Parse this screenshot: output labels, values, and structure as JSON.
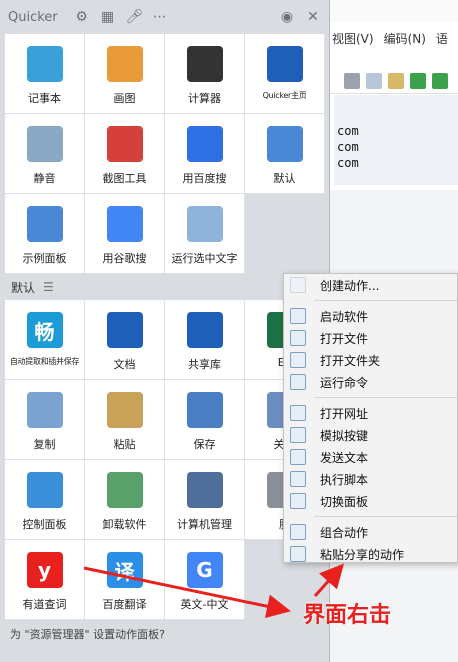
{
  "header": {
    "app_title": "Quicker",
    "icons": [
      "gear-icon",
      "qr-code-icon",
      "microphone-icon",
      "more-icon",
      "user-circle-icon",
      "close-icon"
    ]
  },
  "top_grid": [
    {
      "label": "记事本",
      "icon": "notepad-icon",
      "color": "#3aa0d8"
    },
    {
      "label": "画图",
      "icon": "paint-palette-icon",
      "color": "#e99a39"
    },
    {
      "label": "计算器",
      "icon": "calculator-icon",
      "color": "#333333"
    },
    {
      "label": "Quicker主页",
      "icon": "lightning-icon",
      "color": "#1f5fb7"
    },
    {
      "label": "静音",
      "icon": "speaker-mute-icon",
      "color": "#8aa7c4"
    },
    {
      "label": "截图工具",
      "icon": "scissors-icon",
      "color": "#d6403a"
    },
    {
      "label": "用百度搜",
      "icon": "baidu-paw-icon",
      "color": "#2f6fe4"
    },
    {
      "label": "默认",
      "icon": "window-stack-icon",
      "color": "#4a87d6"
    },
    {
      "label": "示例面板",
      "icon": "window-stack-icon",
      "color": "#4a87d6"
    },
    {
      "label": "用谷歌搜",
      "icon": "google-g-icon",
      "color": "#4285f4"
    },
    {
      "label": "运行选中文字",
      "icon": "lightning-outline-icon",
      "color": "#8fb3d9"
    }
  ],
  "section": {
    "name": "默认"
  },
  "bottom_grid": [
    {
      "label": "自动提取和插并保存",
      "glyph": "畅",
      "icon": "chang-app-icon",
      "color": "#1d9bd7"
    },
    {
      "label": "文档",
      "icon": "lightning-icon",
      "color": "#1f5fb7"
    },
    {
      "label": "共享库",
      "icon": "lightning-icon",
      "color": "#1f5fb7"
    },
    {
      "label": "Ex",
      "icon": "excel-icon",
      "color": "#1e7145"
    },
    {
      "label": "复制",
      "icon": "copy-icon",
      "color": "#7aa3d1"
    },
    {
      "label": "粘贴",
      "icon": "paste-icon",
      "color": "#c9a25a"
    },
    {
      "label": "保存",
      "icon": "floppy-disk-icon",
      "color": "#4a7fc3"
    },
    {
      "label": "关闭",
      "icon": "window-icon",
      "color": "#6b8ec0"
    },
    {
      "label": "控制面板",
      "icon": "control-panel-icon",
      "color": "#3b8fd9"
    },
    {
      "label": "卸载软件",
      "icon": "recycle-bin-icon",
      "color": "#5aa06a"
    },
    {
      "label": "计算机管理",
      "icon": "computer-management-icon",
      "color": "#4d6f9a"
    },
    {
      "label": "服",
      "icon": "services-gear-icon",
      "color": "#8a8f99"
    },
    {
      "label": "有道查词",
      "glyph": "y",
      "icon": "youdao-icon",
      "color": "#e8201e"
    },
    {
      "label": "百度翻译",
      "glyph": "译",
      "icon": "baidu-translate-icon",
      "color": "#2b8fe8"
    },
    {
      "label": "英文-中文",
      "glyph": "G",
      "icon": "google-translate-icon",
      "color": "#4285f4"
    }
  ],
  "context_menu": [
    {
      "label": "创建动作...",
      "icon": "plus-icon"
    },
    {
      "separator": true
    },
    {
      "label": "启动软件",
      "icon": "windows-logo-icon"
    },
    {
      "label": "打开文件",
      "icon": "file-check-icon"
    },
    {
      "label": "打开文件夹",
      "icon": "folder-icon"
    },
    {
      "label": "运行命令",
      "icon": "send-icon"
    },
    {
      "separator": true
    },
    {
      "label": "打开网址",
      "icon": "globe-icon"
    },
    {
      "label": "模拟按键",
      "icon": "keyboard-icon"
    },
    {
      "label": "发送文本",
      "icon": "chat-bubble-icon"
    },
    {
      "label": "执行脚本",
      "icon": "script-icon"
    },
    {
      "label": "切换面板",
      "icon": "panel-icon"
    },
    {
      "separator": true
    },
    {
      "label": "组合动作",
      "icon": "lightning-outline-icon"
    },
    {
      "label": "粘贴分享的动作",
      "icon": "clipboard-icon"
    }
  ],
  "bottom_hint": "为 \"资源管理器\" 设置动作面板?",
  "annotation": {
    "text": "界面右击",
    "color": "#e8201e"
  },
  "background_window": {
    "menu": [
      "视图(V)",
      "编码(N)",
      "语"
    ],
    "code_lines": [
      "com",
      "com",
      "com"
    ]
  }
}
